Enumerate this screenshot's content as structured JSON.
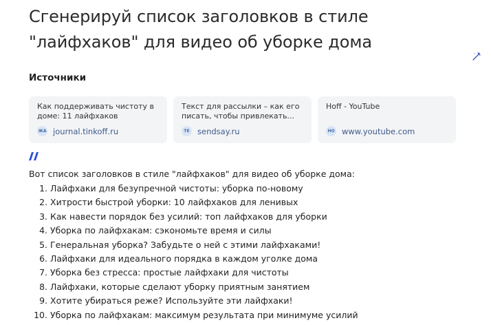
{
  "question": "Сгенерируй список заголовков в стиле \"лайфхаков\" для видео об уборке дома",
  "sources": {
    "title": "Источники",
    "items": [
      {
        "title": "Как поддерживать чистоту в доме: 11 лайфхаков",
        "favicon": "ЖА",
        "domain": "journal.tinkoff.ru"
      },
      {
        "title": "Текст для рассылки – как его писать, чтобы привлекать...",
        "favicon": "ТЕ",
        "domain": "sendsay.ru"
      },
      {
        "title": "Hoff - YouTube",
        "favicon": "НО",
        "domain": "www.youtube.com"
      }
    ]
  },
  "icons": {
    "edit": "magic-wand-icon",
    "brand": "assistant-logo-icon"
  },
  "colors": {
    "accent": "#2d4fd4",
    "card_bg": "#f3f4f6",
    "domain_text": "#3d5a8a"
  },
  "answer": {
    "intro": "Вот список заголовков в стиле \"лайфхаков\" для видео об уборке дома:",
    "items": [
      {
        "num": "1.",
        "text": "Лайфхаки для безупречной чистоты: уборка по-новому"
      },
      {
        "num": "2.",
        "text": "Хитрости быстрой уборки: 10 лайфхаков для ленивых"
      },
      {
        "num": "3.",
        "text": "Как навести порядок без усилий: топ лайфхаков для уборки"
      },
      {
        "num": "4.",
        "text": "Уборка по лайфхакам: сэкономьте время и силы"
      },
      {
        "num": "5.",
        "text": "Генеральная уборка? Забудьте о ней с этими лайфхаками!"
      },
      {
        "num": "6.",
        "text": "Лайфхаки для идеального порядка в каждом уголке дома"
      },
      {
        "num": "7.",
        "text": "Уборка без стресса: простые лайфхаки для чистоты"
      },
      {
        "num": "8.",
        "text": "Лайфхаки, которые сделают уборку приятным занятием"
      },
      {
        "num": "9.",
        "text": "Хотите убираться реже? Используйте эти лайфхаки!"
      },
      {
        "num": "10.",
        "text": "Уборка по лайфхакам: максимум результата при минимуме усилий"
      }
    ]
  }
}
